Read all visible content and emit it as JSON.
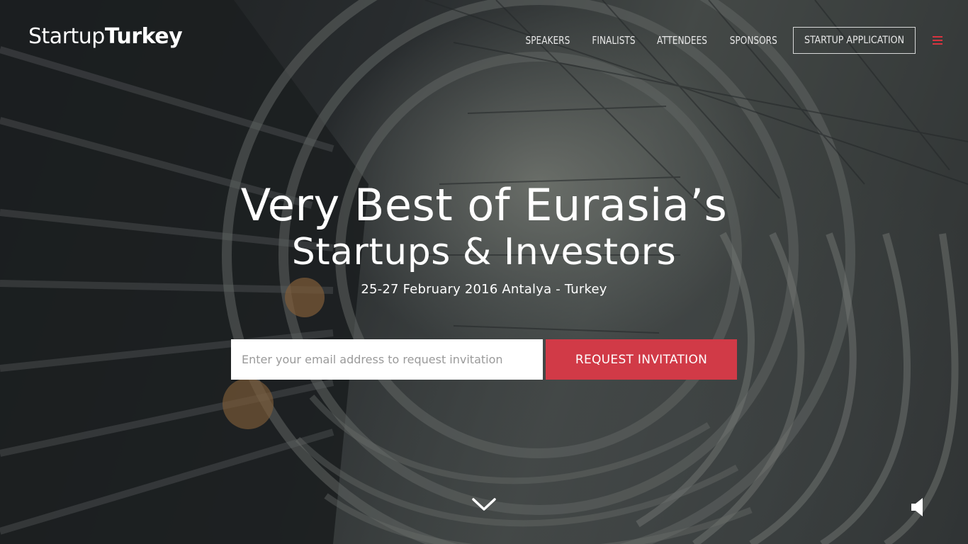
{
  "header": {
    "logo_light": "Startup",
    "logo_bold": "Turkey",
    "nav": {
      "speakers": "SPEAKERS",
      "finalists": "FINALISTS",
      "attendees": "ATTENDEES",
      "sponsors": "SPONSORS",
      "startup_application": "STARTUP APPLICATION"
    },
    "menu_icon": "hamburger-icon"
  },
  "hero": {
    "title_line1": "Very Best of Eurasia’s",
    "title_line2": "Startups & Investors",
    "event_info": "25-27 February 2016 Antalya - Turkey"
  },
  "form": {
    "email_placeholder": "Enter your email address to request invitation",
    "email_value": "",
    "submit_label": "REQUEST INVITATION"
  },
  "controls": {
    "scroll_icon": "chevron-down-icon",
    "sound_icon": "speaker-icon"
  },
  "colors": {
    "accent": "#d13a47",
    "text": "#ffffff"
  }
}
